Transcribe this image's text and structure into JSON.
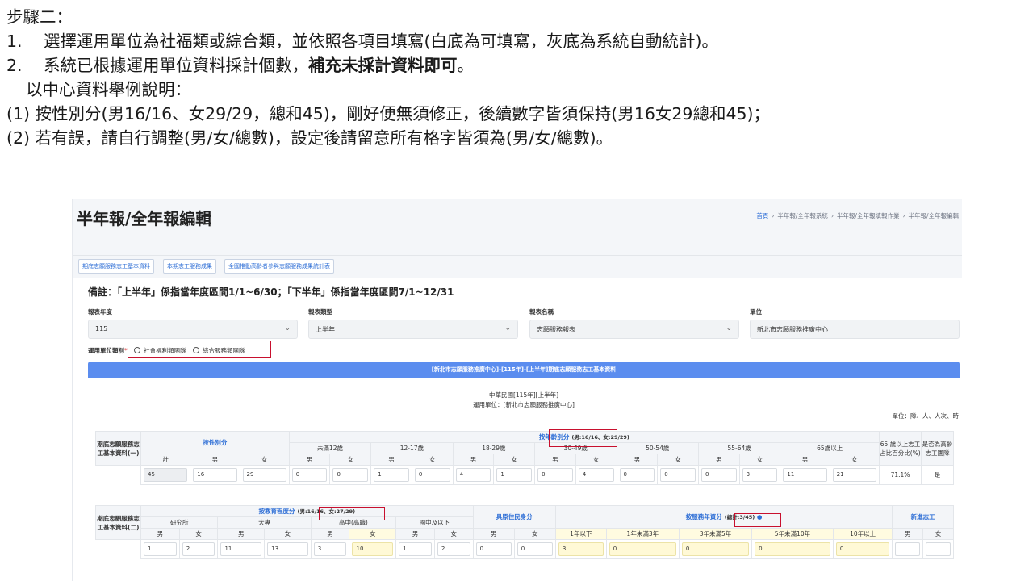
{
  "slide": {
    "step_title": "步驟二：",
    "item1_num": "1.",
    "item1_text": "選擇運用單位為社福類或綜合類，並依照各項目填寫(白底為可填寫，灰底為系統自動統計)。",
    "item2_num": "2.",
    "item2_text_a": "系統已根據運用單位資料採計個數，",
    "item2_text_bold": "補充未採計資料即可",
    "item2_text_b": "。",
    "example_intro": "以中心資料舉例說明：",
    "example1": "(1) 按性別分(男16/16、女29/29，總和45)，剛好便無須修正，後續數字皆須保持(男16女29總和45)；",
    "example2": "(2) 若有誤，請自行調整(男/女/總數)，設定後請留意所有格字皆須為(男/女/總數)。"
  },
  "page": {
    "title": "半年報/全年報編輯",
    "breadcrumb": [
      "首頁",
      "半年報/全年報系統",
      "半年報/全年報填報作業",
      "半年報/全年報編輯"
    ]
  },
  "tabs": [
    "期底志願服務志工基本資料",
    "本期志工服務成果",
    "全國推動高齡者參與志願服務成果統計表"
  ],
  "note": "備註：「上半年」係指當年度區間1/1~6/30；「下半年」係指當年度區間7/1~12/31",
  "form": {
    "year_label": "報表年度",
    "year_value": "115",
    "type_label": "報表類型",
    "type_value": "上半年",
    "name_label": "報表名稱",
    "name_value": "志願服務報表",
    "unit_label": "單位",
    "unit_value": "新北市志願服務推廣中心",
    "category_label": "運用單位類別",
    "category_required": "*",
    "category_options": [
      "社會福利類團隊",
      "綜合服務類團隊"
    ]
  },
  "report": {
    "banner": "[新北市志願服務推廣中心]-[115年]-[上半年]期底志願服務志工基本資料",
    "subtitle1": "中華民國[115年][上半年]",
    "subtitle2": "運用單位：[新北市志願服務推廣中心]",
    "unit_note": "單位：隊、人、人次、時"
  },
  "table1": {
    "row_label": "期底志願服務志工基本資料(一)",
    "gender_group": "按性別分",
    "age_group": "按年齡別分",
    "age_tag": "(男:16/16、女:29/29)",
    "age_brackets": [
      "未滿12歲",
      "12-17歲",
      "18-29歲",
      "30-49歲",
      "50-54歲",
      "55-64歲",
      "65歲以上"
    ],
    "senior_pct_header": "65 歲以上志工占比百分比(%)",
    "senior_team_header": "是否為高齡志工團隊",
    "sub_total": "計",
    "sub_male": "男",
    "sub_female": "女",
    "values": [
      "45",
      "16",
      "29",
      "0",
      "0",
      "1",
      "0",
      "4",
      "1",
      "0",
      "4",
      "0",
      "0",
      "0",
      "3",
      "11",
      "21"
    ],
    "senior_pct": "71.1%",
    "senior_team": "是"
  },
  "table2": {
    "row_label": "期底志願服務志工基本資料(二)",
    "edu_group": "按教育程度分",
    "edu_tag": "(男:16/16、女:27/29)",
    "edu_levels": [
      "研究所",
      "大專",
      "高中(高職)",
      "國中及以下"
    ],
    "indigenous": "具原住民身分",
    "years_group": "按服務年資分",
    "years_tag": "(總計:3/45)",
    "years_brackets": [
      "1年以下",
      "1年未滿3年",
      "3年未滿5年",
      "5年未滿10年",
      "10年以上"
    ],
    "new_vol": "新進志工",
    "sub_male": "男",
    "sub_female": "女",
    "edu_values": [
      "1",
      "2",
      "11",
      "13",
      "3",
      "10",
      "1",
      "2"
    ],
    "indigenous_values": [
      "0",
      "0"
    ],
    "years_values": [
      "3",
      "0",
      "0",
      "0",
      "0"
    ],
    "new_values": [
      "",
      ""
    ]
  }
}
